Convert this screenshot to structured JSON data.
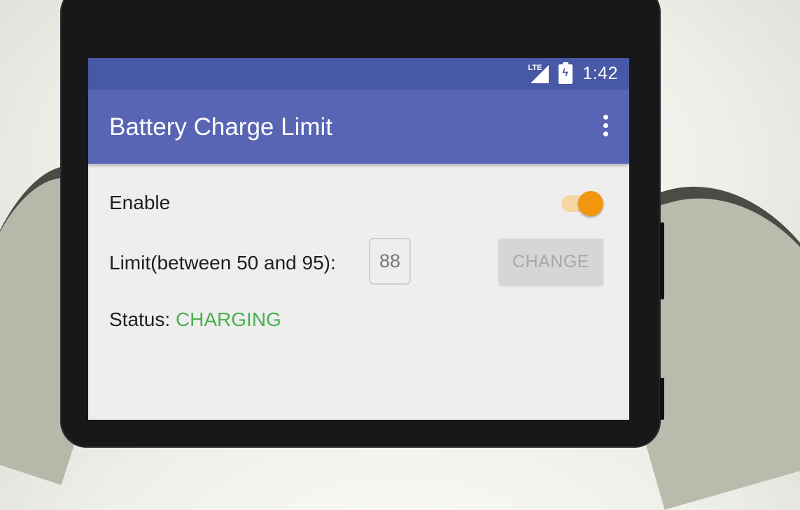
{
  "statusbar": {
    "network_label": "LTE",
    "network_icon": "lte-signal-icon",
    "battery_icon": "battery-charging-icon",
    "time": "1:42"
  },
  "appbar": {
    "title": "Battery Charge Limit",
    "menu_icon": "more-vert-icon"
  },
  "settings": {
    "enable_label": "Enable",
    "enable_on": true,
    "limit_label": "Limit(between 50 and 95):",
    "limit_placeholder": "88",
    "change_label": "CHANGE",
    "status_label": "Status: ",
    "status_value": "CHARGING"
  },
  "colors": {
    "statusbar": "#4658a6",
    "appbar": "#5864b4",
    "toggle_thumb": "#f2960e",
    "status_ok": "#4caf50"
  }
}
